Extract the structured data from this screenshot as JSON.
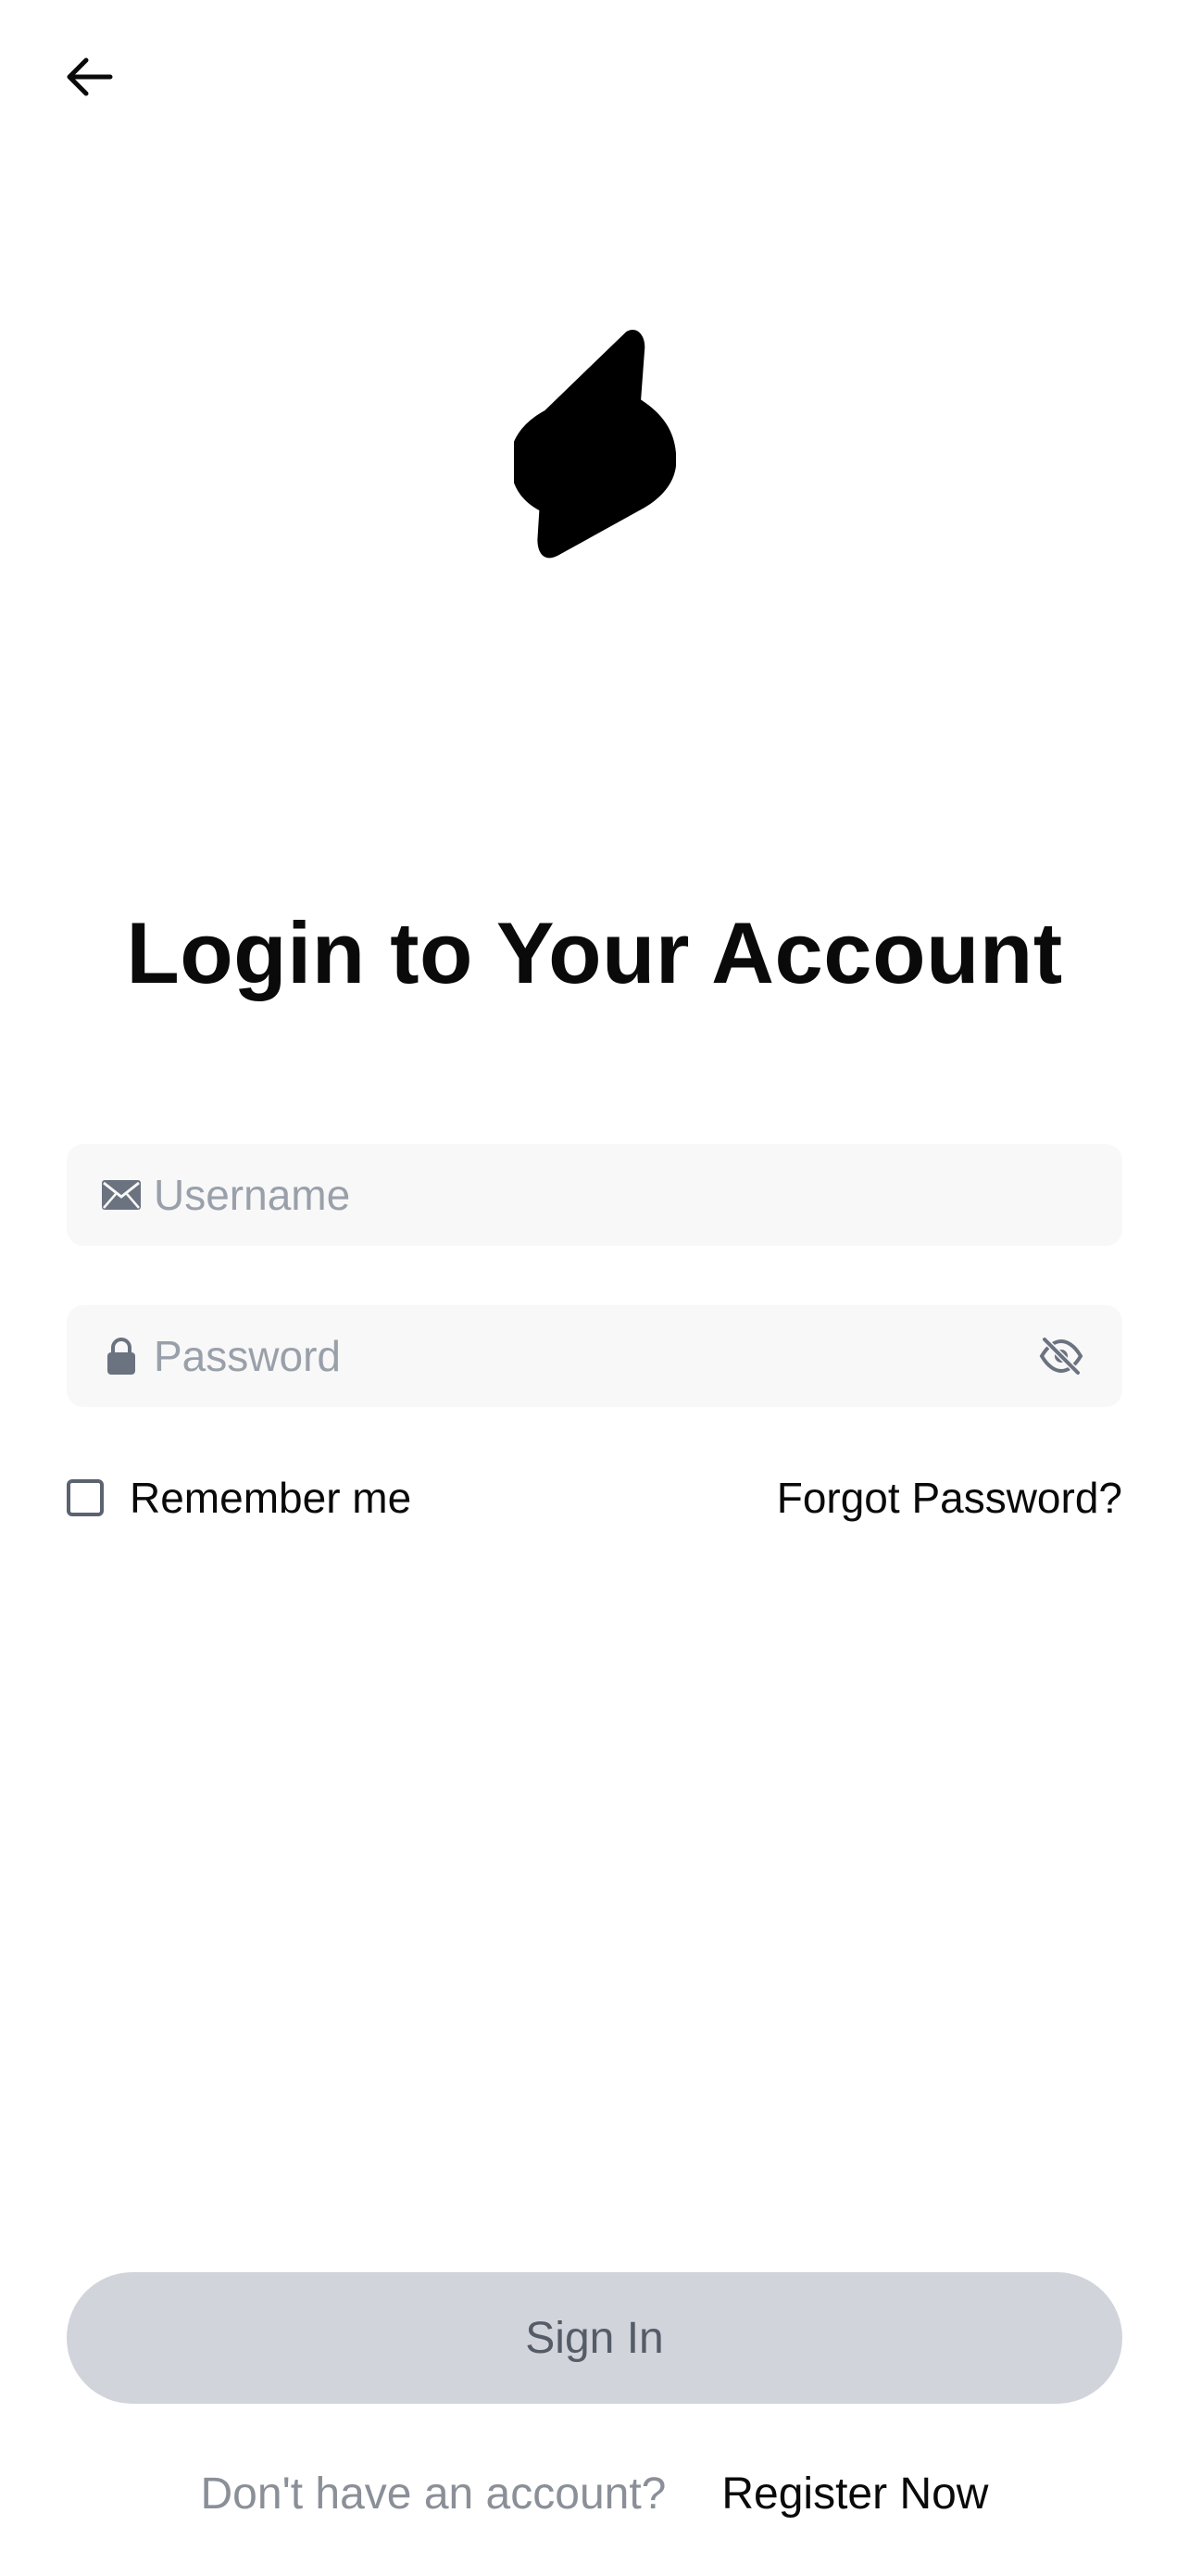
{
  "header": {
    "back_icon": "arrow-left-icon"
  },
  "logo": {
    "icon": "s-brand-logo"
  },
  "title": "Login to Your Account",
  "form": {
    "username": {
      "icon": "envelope-icon",
      "placeholder": "Username",
      "value": ""
    },
    "password": {
      "icon": "lock-icon",
      "placeholder": "Password",
      "value": "",
      "toggle_icon": "eye-slash-icon"
    },
    "remember_label": "Remember me",
    "remember_checked": false,
    "forgot_label": "Forgot Password?"
  },
  "signin_label": "Sign In",
  "footer": {
    "prompt": "Don't have an account?",
    "register_label": "Register Now"
  },
  "colors": {
    "field_bg": "#f8f8f8",
    "placeholder": "#9aa0aa",
    "button_disabled_bg": "#d1d4da",
    "button_disabled_text": "#555c68",
    "muted_text": "#8a8f98",
    "icon_gray": "#6b7280"
  }
}
